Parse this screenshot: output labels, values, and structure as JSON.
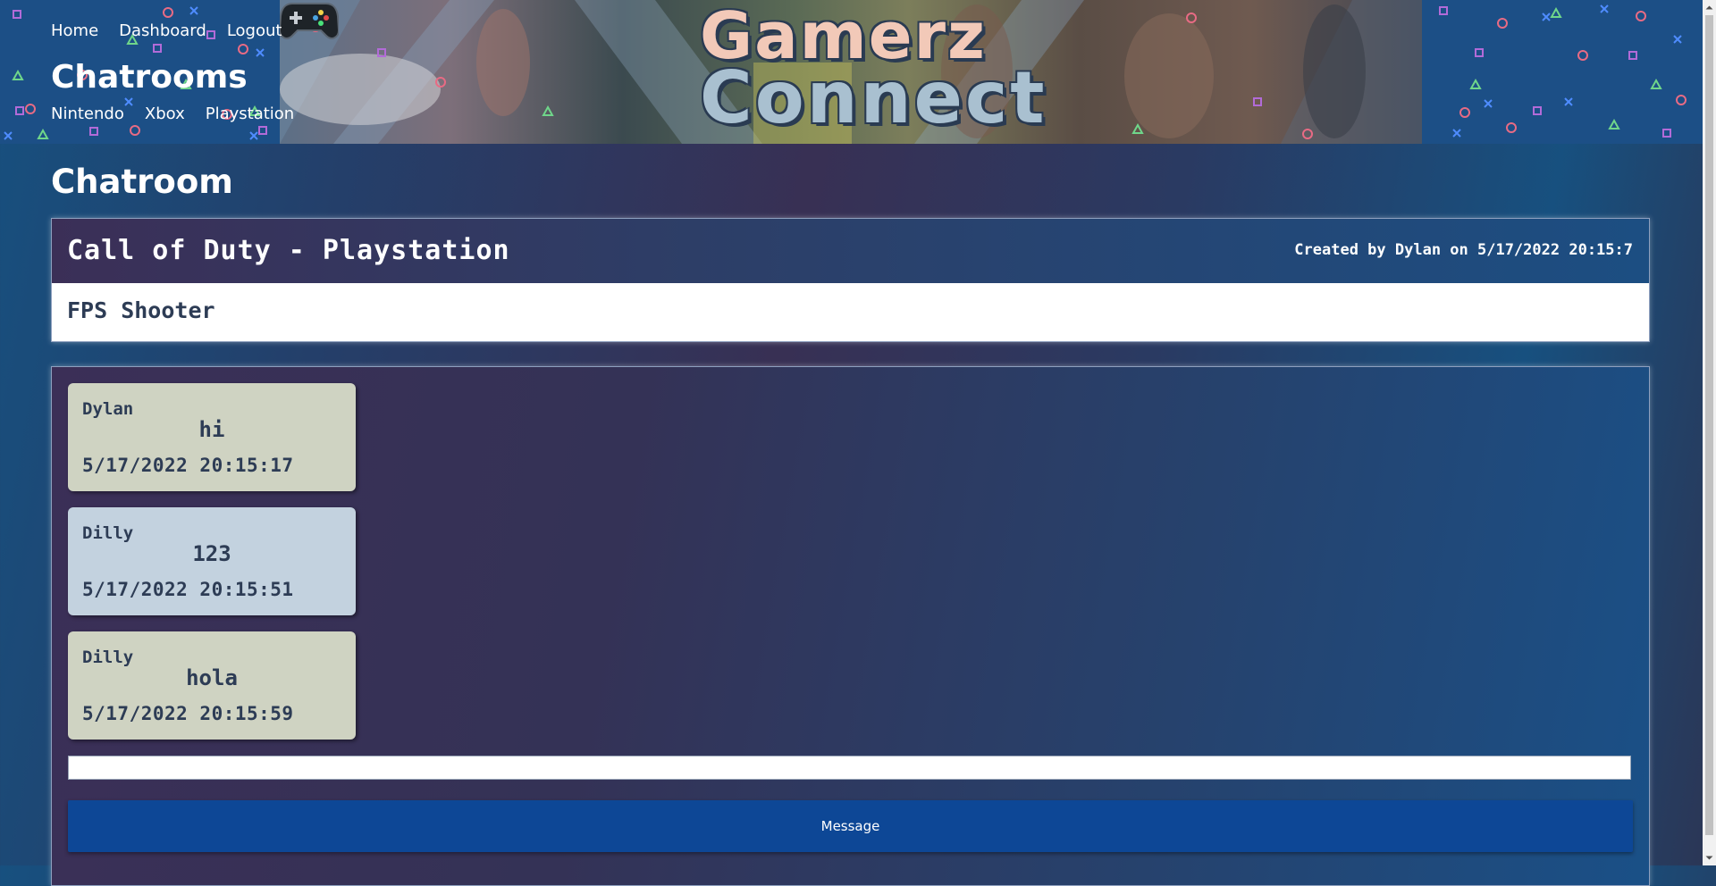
{
  "nav": {
    "home": "Home",
    "dashboard": "Dashboard",
    "logout": "Logout"
  },
  "site_title": "Chatrooms",
  "platforms": [
    "Nintendo",
    "Xbox",
    "Playstation"
  ],
  "logo": {
    "line1": "Gamerz",
    "line2": "Connect",
    "icon": "gamepad-icon"
  },
  "page_heading": "Chatroom",
  "room": {
    "title": "Call of Duty - Playstation",
    "created": "Created by Dylan on 5/17/2022 20:15:7",
    "description": "FPS Shooter"
  },
  "messages": [
    {
      "user": "Dylan",
      "text": "hi",
      "time": "5/17/2022 20:15:17",
      "color": "#cfd3c2"
    },
    {
      "user": "Dilly",
      "text": "123",
      "time": "5/17/2022 20:15:51",
      "color": "#c3d2df"
    },
    {
      "user": "Dilly",
      "text": "hola",
      "time": "5/17/2022 20:15:59",
      "color": "#cfd3c2"
    }
  ],
  "composer": {
    "value": "",
    "button_label": "Message"
  },
  "colors": {
    "button": "#0d4796",
    "text_dark": "#2d3c55"
  }
}
